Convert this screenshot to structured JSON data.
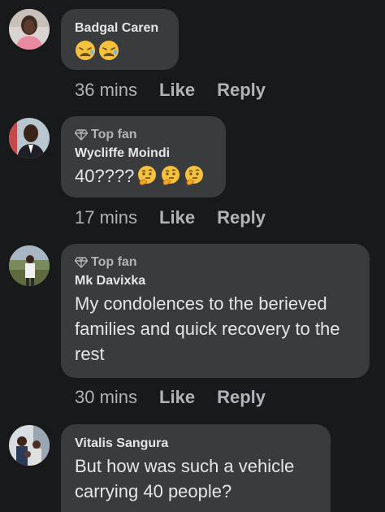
{
  "comments": [
    {
      "author": "Badgal Caren",
      "badge": "",
      "text": "",
      "emojis": [
        "weary-face-emoji",
        "weary-face-emoji"
      ],
      "time": "36 mins",
      "like_label": "Like",
      "reply_label": "Reply"
    },
    {
      "author": "Wycliffe Moindi",
      "badge": "Top fan",
      "text": "40????",
      "emojis": [
        "thinking-face-emoji",
        "thinking-face-emoji",
        "thinking-face-emoji"
      ],
      "time": "17 mins",
      "like_label": "Like",
      "reply_label": "Reply"
    },
    {
      "author": "Mk Davixka",
      "badge": "Top fan",
      "text": "My condolences to the berieved families and quick recovery to the rest",
      "emojis": [],
      "time": "30 mins",
      "like_label": "Like",
      "reply_label": "Reply"
    },
    {
      "author": "Vitalis Sangura",
      "badge": "",
      "text": "But how was such a vehicle carrying 40 people?",
      "emojis": [],
      "time": "",
      "like_label": "",
      "reply_label": ""
    }
  ],
  "colors": {
    "background": "#18191a",
    "bubble": "#3a3b3c",
    "primary_text": "#e4e6eb",
    "secondary_text": "#b0b3b8",
    "emoji_face": "#f7c23b"
  }
}
